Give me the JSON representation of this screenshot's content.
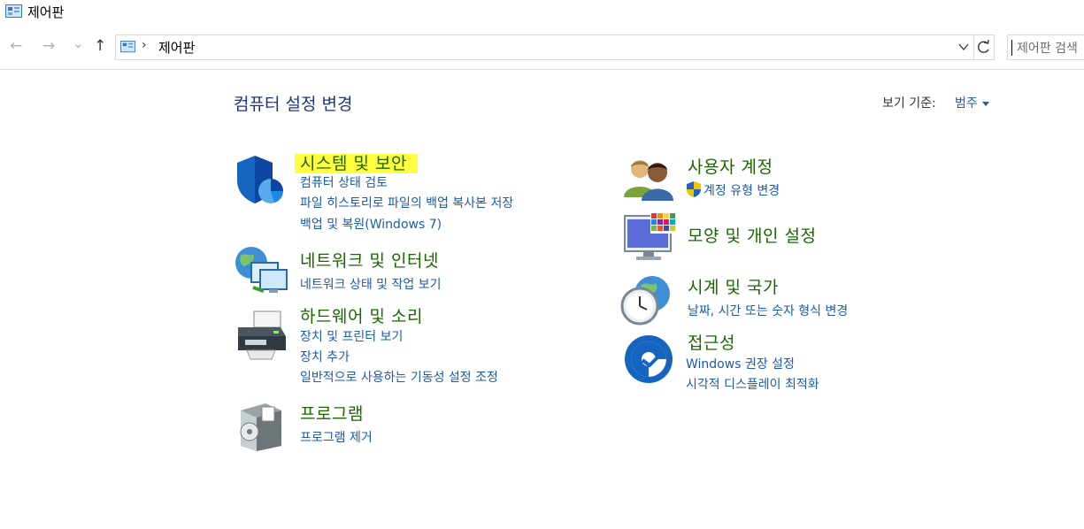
{
  "window": {
    "title": "제어판"
  },
  "nav": {
    "back": "←",
    "forward": "→",
    "recent": "⌄",
    "up": "↑"
  },
  "address": {
    "separator": "›",
    "path": "제어판"
  },
  "search": {
    "placeholder": "제어판 검색"
  },
  "main": {
    "heading": "컴퓨터 설정 변경",
    "view_by_label": "보기 기준:",
    "view_by_value": "범주"
  },
  "categories": {
    "system_security": {
      "title": "시스템 및 보안",
      "links": [
        "컴퓨터 상태 검토",
        "파일 히스토리로 파일의 백업 복사본 저장",
        "백업 및 복원(Windows 7)"
      ]
    },
    "network": {
      "title": "네트워크 및 인터넷",
      "links": [
        "네트워크 상태 및 작업 보기"
      ]
    },
    "hardware": {
      "title": "하드웨어 및 소리",
      "links": [
        "장치 및 프린터 보기",
        "장치 추가",
        "일반적으로 사용하는 기동성 설정 조정"
      ]
    },
    "programs": {
      "title": "프로그램",
      "links": [
        "프로그램 제거"
      ]
    },
    "user_accounts": {
      "title": "사용자 계정",
      "links": [
        "계정 유형 변경"
      ]
    },
    "appearance": {
      "title": "모양 및 개인 설정",
      "links": []
    },
    "clock_region": {
      "title": "시계 및 국가",
      "links": [
        "날짜, 시간 또는 숫자 형식 변경"
      ]
    },
    "accessibility": {
      "title": "접근성",
      "links": [
        "Windows 권장 설정",
        "시각적 디스플레이 최적화"
      ]
    }
  },
  "colors": {
    "category_title": "#1b6600",
    "link": "#1a5bb3",
    "heading": "#1e3287",
    "highlight": "#ffff40"
  },
  "icons": {
    "title": "control-panel-icon",
    "system_security": "shield-icon",
    "network": "globe-monitors-icon",
    "hardware": "printer-icon",
    "programs": "program-box-icon",
    "user_accounts": "users-icon",
    "uac": "uac-shield-icon",
    "appearance": "monitor-palette-icon",
    "clock_region": "clock-globe-icon",
    "accessibility": "ease-of-access-icon"
  }
}
